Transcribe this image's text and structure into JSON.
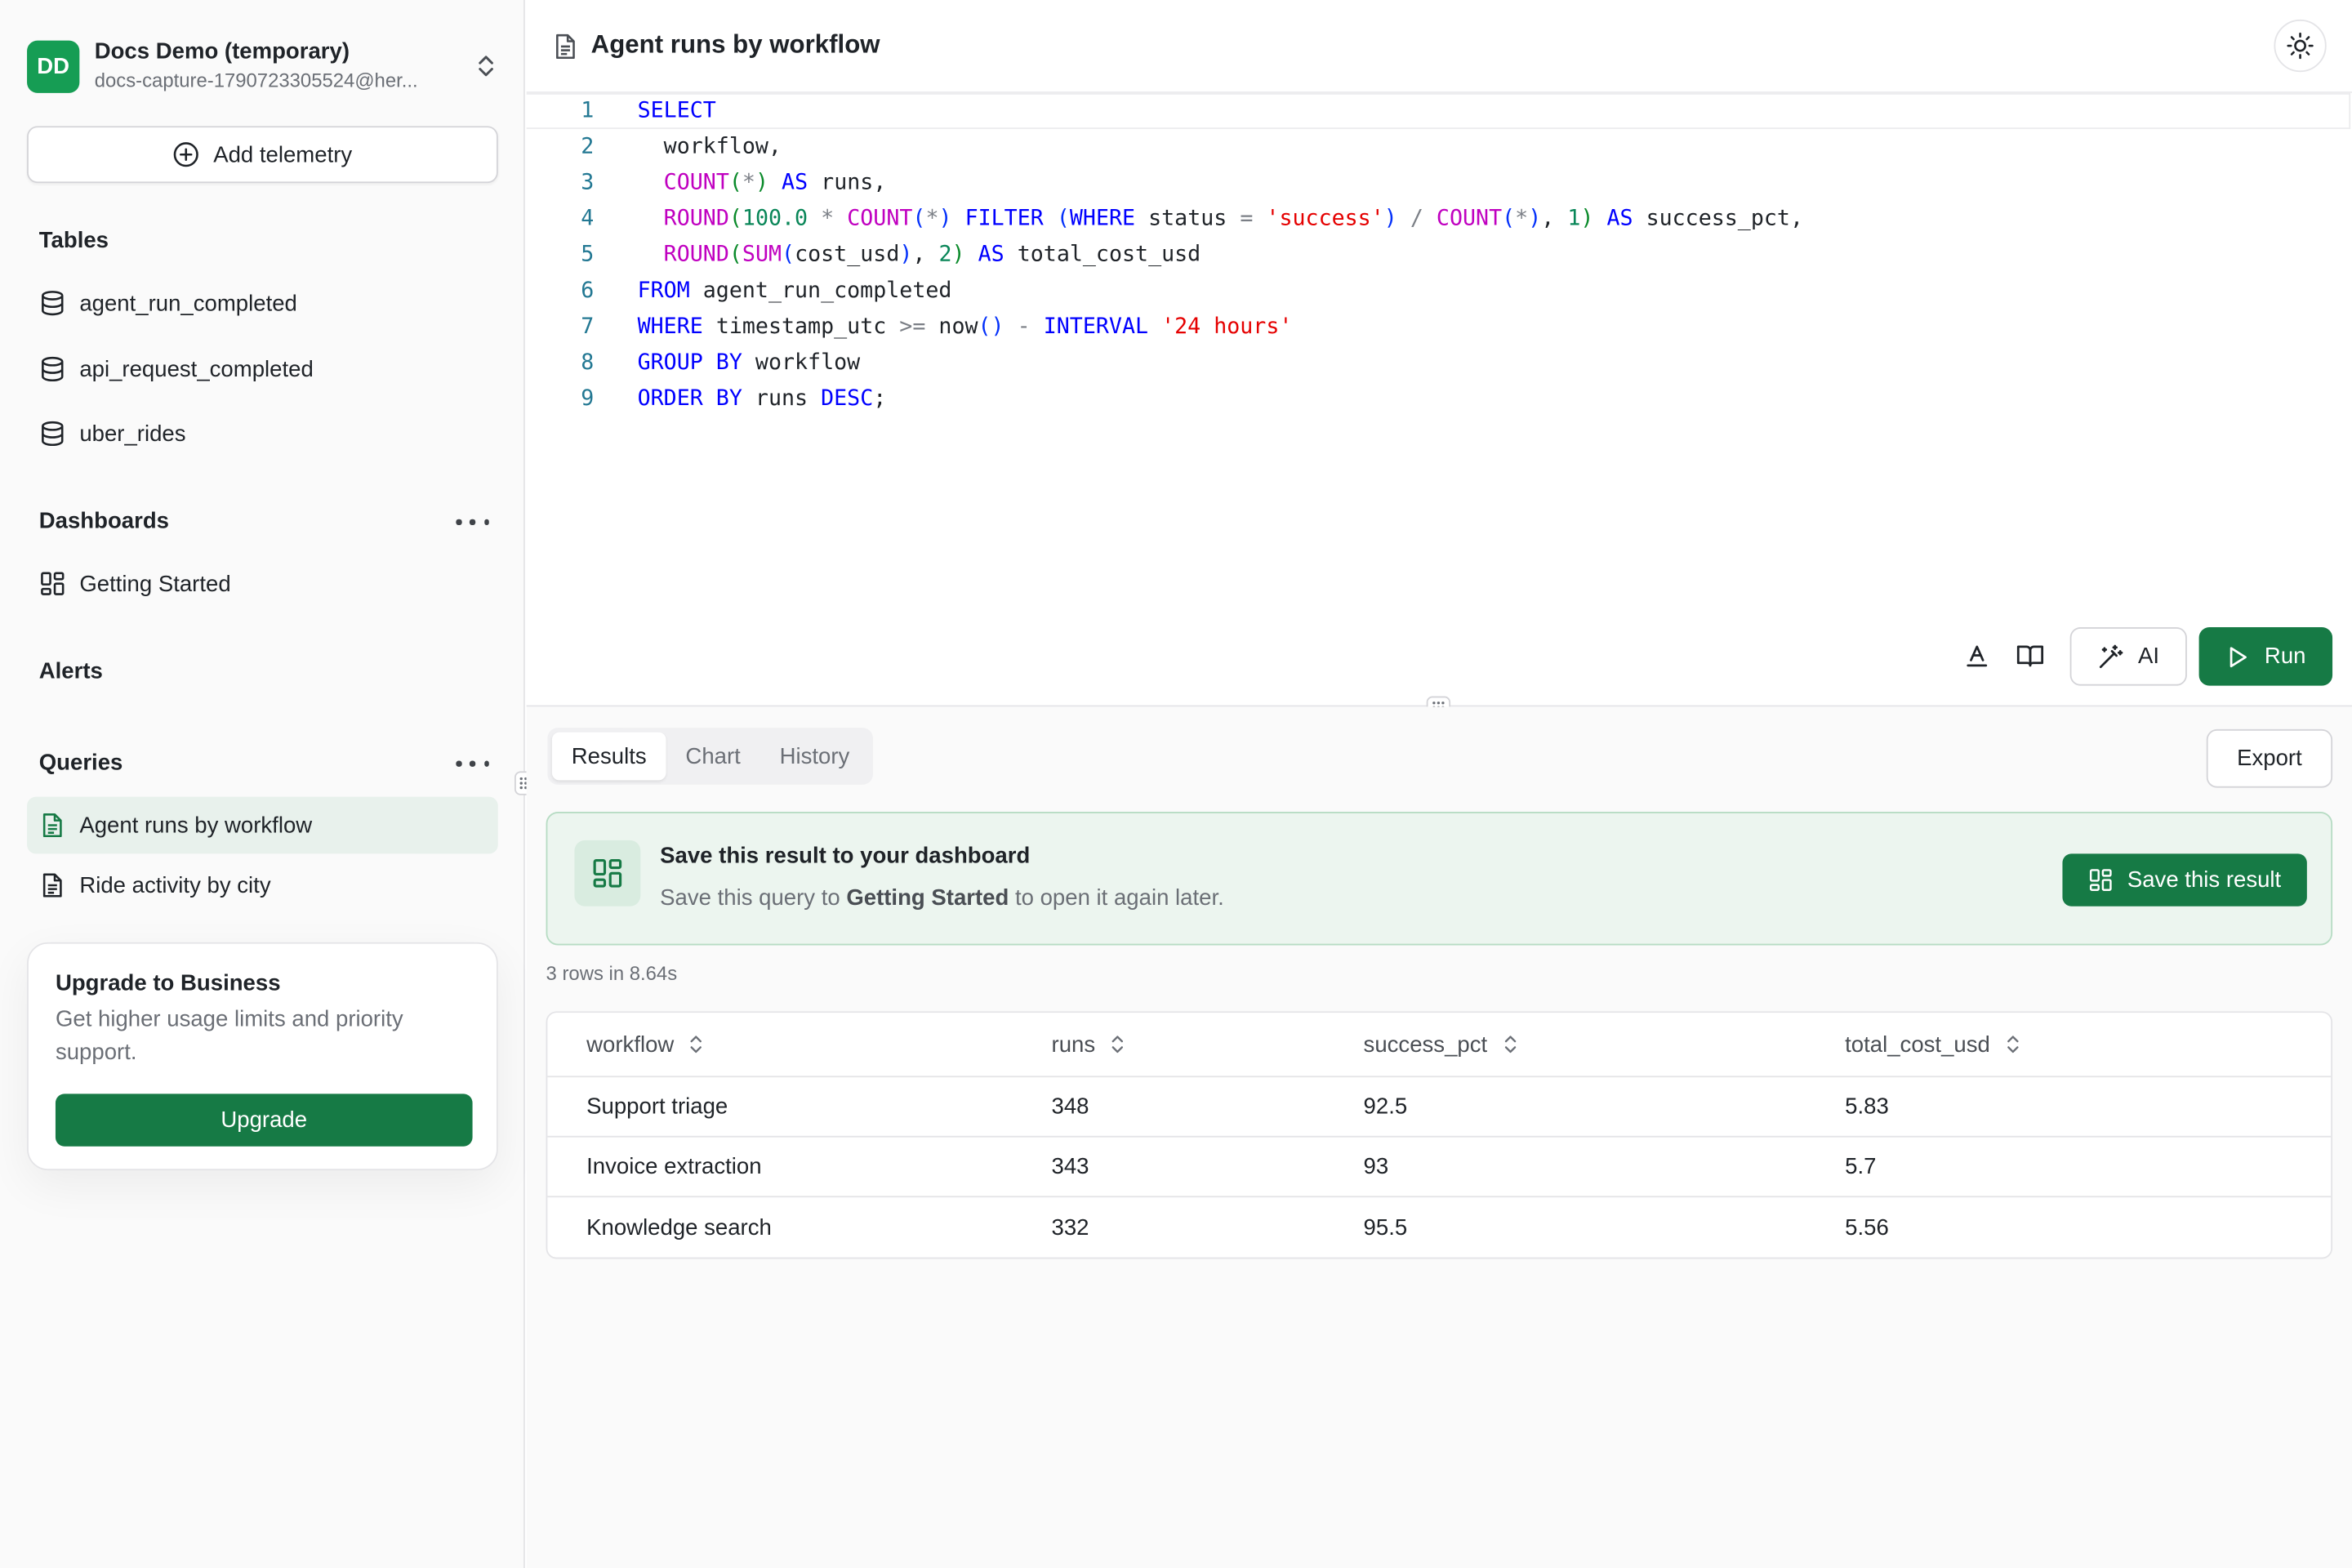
{
  "org": {
    "initials": "DD",
    "name": "Docs Demo (temporary)",
    "email": "docs-capture-1790723305524@her..."
  },
  "sidebar": {
    "add_telemetry": "Add telemetry",
    "tables_title": "Tables",
    "tables": [
      {
        "label": "agent_run_completed",
        "icon": "database-icon"
      },
      {
        "label": "api_request_completed",
        "icon": "database-icon"
      },
      {
        "label": "uber_rides",
        "icon": "database-icon"
      }
    ],
    "dashboards_title": "Dashboards",
    "dashboards": [
      {
        "label": "Getting Started",
        "icon": "dashboard-grid-icon"
      }
    ],
    "alerts_title": "Alerts",
    "queries_title": "Queries",
    "queries": [
      {
        "label": "Agent runs by workflow",
        "icon": "document-icon",
        "active": true
      },
      {
        "label": "Ride activity by city",
        "icon": "document-icon",
        "active": false
      }
    ],
    "upgrade": {
      "title": "Upgrade to Business",
      "description": "Get higher usage limits and priority support.",
      "button": "Upgrade"
    }
  },
  "header": {
    "title": "Agent runs by workflow"
  },
  "editor": {
    "line_numbers": [
      "1",
      "2",
      "3",
      "4",
      "5",
      "6",
      "7",
      "8",
      "9"
    ]
  },
  "toolbar": {
    "ai_label": "AI",
    "run_label": "Run"
  },
  "results": {
    "tabs": [
      "Results",
      "Chart",
      "History"
    ],
    "active_tab": "Results",
    "export_label": "Export",
    "banner": {
      "title": "Save this result to your dashboard",
      "desc_before": "Save this query to ",
      "desc_bold": "Getting Started",
      "desc_after": " to open it again later.",
      "button": "Save this result"
    },
    "row_count": "3 rows in 8.64s",
    "columns": [
      "workflow",
      "runs",
      "success_pct",
      "total_cost_usd"
    ],
    "rows": [
      [
        "Support triage",
        "348",
        "92.5",
        "5.83"
      ],
      [
        "Invoice extraction",
        "343",
        "93",
        "5.7"
      ],
      [
        "Knowledge search",
        "332",
        "95.5",
        "5.56"
      ]
    ]
  },
  "colors": {
    "brand_green": "#167a45",
    "avatar_green": "#169d54",
    "banner_bg": "#ecf5ef",
    "keyword_blue": "#0000ff",
    "function_magenta": "#c000c0",
    "number_green": "#098658",
    "string_red": "#e50000"
  }
}
